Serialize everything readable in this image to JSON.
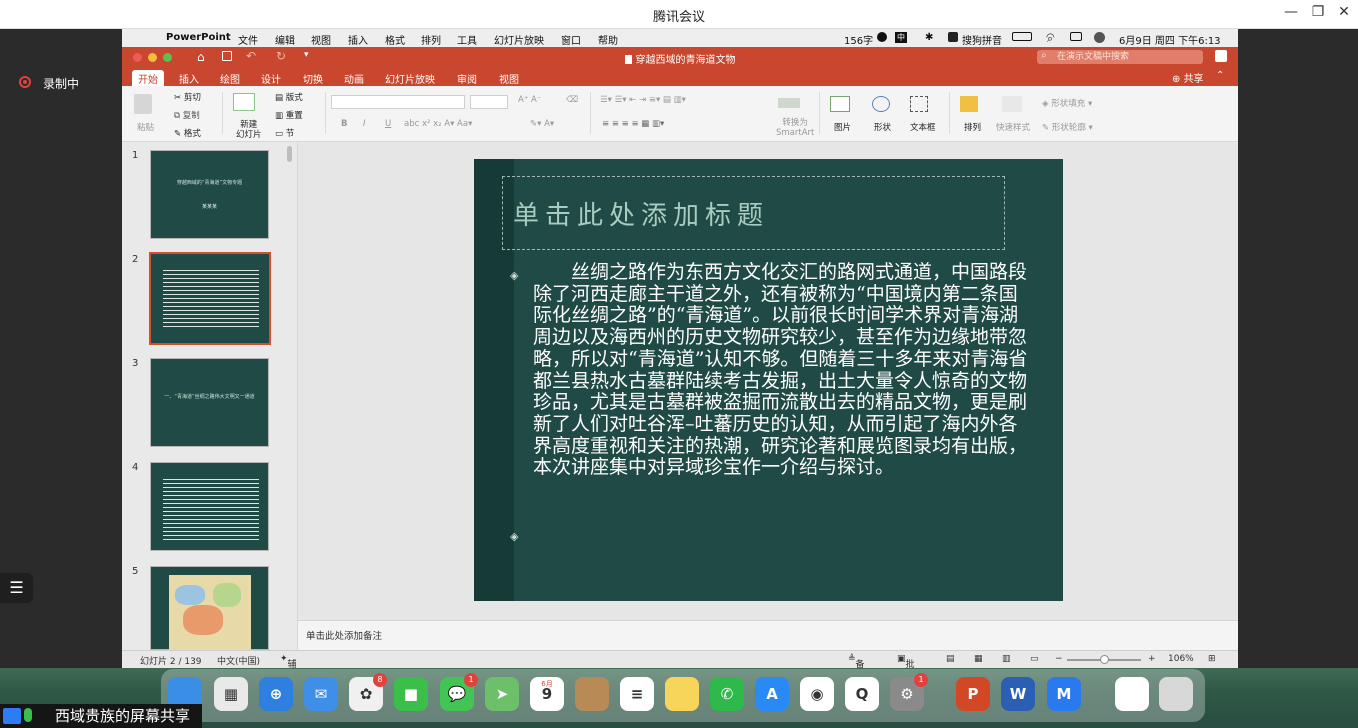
{
  "window": {
    "title": "腾讯会议",
    "controls": [
      "—",
      "❐",
      "✕"
    ]
  },
  "meeting": {
    "recording_label": "录制中",
    "share_label": "西域贵族的屏幕共享",
    "list_icon": "☰"
  },
  "menubar": {
    "apple": "",
    "app": "PowerPoint",
    "items": [
      "文件",
      "编辑",
      "视图",
      "插入",
      "格式",
      "排列",
      "工具",
      "幻灯片放映",
      "窗口",
      "帮助"
    ],
    "word_count": "156字",
    "input_method": "搜狗拼音",
    "datetime": "6月9日 周四 下午6:13"
  },
  "ppt": {
    "doc_title": "穿越西域的青海道文物",
    "search_placeholder": "在演示文稿中搜索",
    "share": "共享",
    "tabs": [
      "开始",
      "插入",
      "绘图",
      "设计",
      "切换",
      "动画",
      "幻灯片放映",
      "审阅",
      "视图"
    ],
    "ribbon": {
      "paste": "粘贴",
      "cut": "剪切",
      "copy": "复制",
      "format": "格式",
      "new_slide": "新建\n幻灯片",
      "layout": "版式",
      "reset": "重置",
      "section": "节",
      "convert": "转换为\nSmartArt",
      "picture": "图片",
      "shape": "形状",
      "textbox": "文本框",
      "arrange": "排列",
      "quick_styles": "快速样式",
      "shape_fill": "形状填充",
      "shape_outline": "形状轮廓",
      "bold": "B",
      "italic": "I",
      "underline": "U"
    },
    "thumbs": [
      {
        "num": "1",
        "title": "穿越西域的“青海道”文物专题",
        "sub": "某某某"
      },
      {
        "num": "2",
        "title": ""
      },
      {
        "num": "3",
        "title": "一、“青海道”丝绸之路伟大文明又一通道"
      },
      {
        "num": "4",
        "title": ""
      },
      {
        "num": "5",
        "title": ""
      }
    ],
    "slide": {
      "title": "单击此处添加标题",
      "body": "丝绸之路作为东西方文化交汇的路网式通道，中国路段除了河西走廊主干道之外，还有被称为“中国境内第二条国际化丝绸之路”的“青海道”。以前很长时间学术界对青海湖周边以及海西州的历史文物研究较少，甚至作为边缘地带忽略，所以对“青海道”认知不够。但随着三十多年来对青海省都兰县热水古墓群陆续考古发掘，出土大量令人惊奇的文物珍品，尤其是古墓群被盗掘而流散出去的精品文物，更是刷新了人们对吐谷浑–吐蕃历史的认知，从而引起了海内外各界高度重视和关注的热潮，研究论著和展览图录均有出版，本次讲座集中对异域珍宝作一介绍与探讨。",
      "bullet": "◈"
    },
    "notes_placeholder": "单击此处添加备注",
    "status": {
      "slide_pos": "幻灯片 2 / 139",
      "lang": "中文(中国)",
      "accessibility": "辅助功能: 调查",
      "notes": "备注",
      "comments": "批注",
      "zoom": "106%"
    }
  },
  "dock": {
    "apps": [
      {
        "name": "finder",
        "label": "",
        "color": "#3a8ee6"
      },
      {
        "name": "launchpad",
        "label": "▦",
        "color": "#e9e9e9"
      },
      {
        "name": "safari",
        "label": "⊕",
        "color": "#2f7fe0"
      },
      {
        "name": "mail",
        "label": "✉",
        "color": "#3f8fe8"
      },
      {
        "name": "photos",
        "label": "✿",
        "color": "#f0f0f0",
        "badge": "8"
      },
      {
        "name": "facetime",
        "label": "■",
        "color": "#3bbf4a"
      },
      {
        "name": "messages",
        "label": "💬",
        "color": "#43c454",
        "badge": "1"
      },
      {
        "name": "maps",
        "label": "➤",
        "color": "#6dbf6a"
      },
      {
        "name": "calendar",
        "label": "9",
        "color": "#ffffff",
        "sub": "6月"
      },
      {
        "name": "contacts",
        "label": "",
        "color": "#b88a55"
      },
      {
        "name": "reminders",
        "label": "≡",
        "color": "#ffffff"
      },
      {
        "name": "notes",
        "label": "",
        "color": "#f7d55a"
      },
      {
        "name": "wechat",
        "label": "✆",
        "color": "#2fb94a"
      },
      {
        "name": "appstore",
        "label": "A",
        "color": "#2a8af5"
      },
      {
        "name": "chrome",
        "label": "◉",
        "color": "#ffffff"
      },
      {
        "name": "qq",
        "label": "Q",
        "color": "#ffffff"
      },
      {
        "name": "settings",
        "label": "⚙",
        "color": "#8a8a8a",
        "badge": "1"
      },
      {
        "name": "powerpoint",
        "label": "P",
        "color": "#d24726"
      },
      {
        "name": "word",
        "label": "W",
        "color": "#2b5fb3"
      },
      {
        "name": "tencent-meeting",
        "label": "M",
        "color": "#2a79ee"
      },
      {
        "name": "preview",
        "label": "",
        "color": "#ffffff"
      },
      {
        "name": "trash",
        "label": "",
        "color": "#d8d8d8"
      }
    ]
  }
}
